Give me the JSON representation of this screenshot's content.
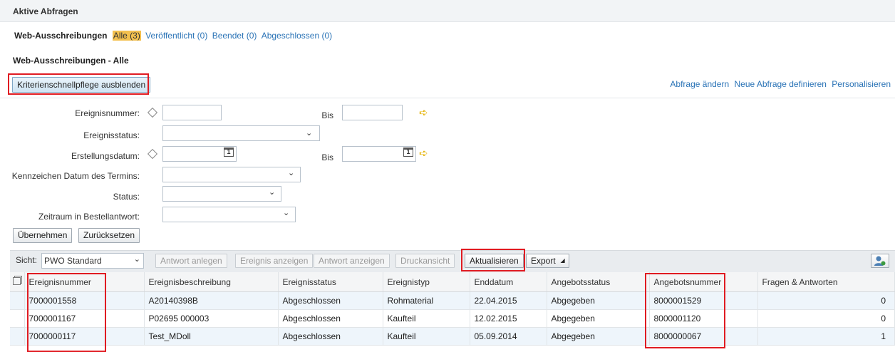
{
  "page": {
    "title": "Aktive Abfragen"
  },
  "filter_tabs": {
    "label": "Web-Ausschreibungen",
    "items": [
      {
        "label": "Alle (3)",
        "selected": true
      },
      {
        "label": "Veröffentlicht (0)"
      },
      {
        "label": "Beendet (0)"
      },
      {
        "label": "Abgeschlossen (0)"
      }
    ]
  },
  "section_title": "Web-Ausschreibungen - Alle",
  "toggle_button": "Kriterienschnellpflege ausblenden",
  "query_links": {
    "change": "Abfrage ändern",
    "new": "Neue Abfrage definieren",
    "personalize": "Personalisieren"
  },
  "criteria": {
    "event_number_label": "Ereignisnummer:",
    "event_status_label": "Ereignisstatus:",
    "creation_date_label": "Erstellungsdatum:",
    "deadline_flag_label": "Kennzeichen Datum des Termins:",
    "status_label": "Status:",
    "period_label": "Zeitraum in Bestellantwort:",
    "to_label": "Bis",
    "calendar_day": "1"
  },
  "criteria_buttons": {
    "apply": "Übernehmen",
    "reset": "Zurücksetzen"
  },
  "toolbar": {
    "view_label": "Sicht:",
    "view_value": "PWO Standard",
    "create_response": "Antwort anlegen",
    "show_event": "Ereignis anzeigen",
    "show_response": "Antwort anzeigen",
    "print_view": "Druckansicht",
    "refresh": "Aktualisieren",
    "export": "Export"
  },
  "table": {
    "columns": [
      "Ereignisnummer",
      "Ereignisbeschreibung",
      "Ereignisstatus",
      "Ereignistyp",
      "Enddatum",
      "Angebotsstatus",
      "Angebotsnummer",
      "Fragen & Antworten"
    ],
    "rows": [
      [
        "7000001558",
        "A20140398B",
        "Abgeschlossen",
        "Rohmaterial",
        "22.04.2015",
        "Abgegeben",
        "8000001529",
        "0"
      ],
      [
        "7000001167",
        "P02695 000003",
        "Abgeschlossen",
        "Kaufteil",
        "12.02.2015",
        "Abgegeben",
        "8000001120",
        "0"
      ],
      [
        "7000000117",
        "Test_MDoll",
        "Abgeschlossen",
        "Kaufteil",
        "05.09.2014",
        "Abgegeben",
        "8000000067",
        "1"
      ]
    ]
  },
  "colors": {
    "link": "#2a73b6",
    "selected_tab": "#f3c04f",
    "highlight": "#e01b22",
    "alt_row": "#eef5fb"
  }
}
